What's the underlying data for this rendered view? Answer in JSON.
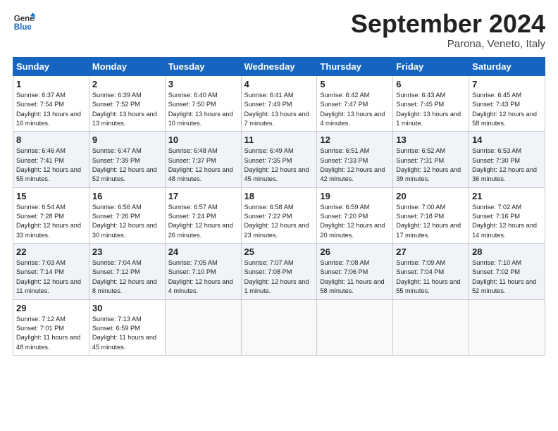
{
  "header": {
    "logo_line1": "General",
    "logo_line2": "Blue",
    "month_title": "September 2024",
    "subtitle": "Parona, Veneto, Italy"
  },
  "weekdays": [
    "Sunday",
    "Monday",
    "Tuesday",
    "Wednesday",
    "Thursday",
    "Friday",
    "Saturday"
  ],
  "weeks": [
    [
      {
        "day": "1",
        "sunrise": "Sunrise: 6:37 AM",
        "sunset": "Sunset: 7:54 PM",
        "daylight": "Daylight: 13 hours and 16 minutes."
      },
      {
        "day": "2",
        "sunrise": "Sunrise: 6:39 AM",
        "sunset": "Sunset: 7:52 PM",
        "daylight": "Daylight: 13 hours and 13 minutes."
      },
      {
        "day": "3",
        "sunrise": "Sunrise: 6:40 AM",
        "sunset": "Sunset: 7:50 PM",
        "daylight": "Daylight: 13 hours and 10 minutes."
      },
      {
        "day": "4",
        "sunrise": "Sunrise: 6:41 AM",
        "sunset": "Sunset: 7:49 PM",
        "daylight": "Daylight: 13 hours and 7 minutes."
      },
      {
        "day": "5",
        "sunrise": "Sunrise: 6:42 AM",
        "sunset": "Sunset: 7:47 PM",
        "daylight": "Daylight: 13 hours and 4 minutes."
      },
      {
        "day": "6",
        "sunrise": "Sunrise: 6:43 AM",
        "sunset": "Sunset: 7:45 PM",
        "daylight": "Daylight: 13 hours and 1 minute."
      },
      {
        "day": "7",
        "sunrise": "Sunrise: 6:45 AM",
        "sunset": "Sunset: 7:43 PM",
        "daylight": "Daylight: 12 hours and 58 minutes."
      }
    ],
    [
      {
        "day": "8",
        "sunrise": "Sunrise: 6:46 AM",
        "sunset": "Sunset: 7:41 PM",
        "daylight": "Daylight: 12 hours and 55 minutes."
      },
      {
        "day": "9",
        "sunrise": "Sunrise: 6:47 AM",
        "sunset": "Sunset: 7:39 PM",
        "daylight": "Daylight: 12 hours and 52 minutes."
      },
      {
        "day": "10",
        "sunrise": "Sunrise: 6:48 AM",
        "sunset": "Sunset: 7:37 PM",
        "daylight": "Daylight: 12 hours and 48 minutes."
      },
      {
        "day": "11",
        "sunrise": "Sunrise: 6:49 AM",
        "sunset": "Sunset: 7:35 PM",
        "daylight": "Daylight: 12 hours and 45 minutes."
      },
      {
        "day": "12",
        "sunrise": "Sunrise: 6:51 AM",
        "sunset": "Sunset: 7:33 PM",
        "daylight": "Daylight: 12 hours and 42 minutes."
      },
      {
        "day": "13",
        "sunrise": "Sunrise: 6:52 AM",
        "sunset": "Sunset: 7:31 PM",
        "daylight": "Daylight: 12 hours and 39 minutes."
      },
      {
        "day": "14",
        "sunrise": "Sunrise: 6:53 AM",
        "sunset": "Sunset: 7:30 PM",
        "daylight": "Daylight: 12 hours and 36 minutes."
      }
    ],
    [
      {
        "day": "15",
        "sunrise": "Sunrise: 6:54 AM",
        "sunset": "Sunset: 7:28 PM",
        "daylight": "Daylight: 12 hours and 33 minutes."
      },
      {
        "day": "16",
        "sunrise": "Sunrise: 6:56 AM",
        "sunset": "Sunset: 7:26 PM",
        "daylight": "Daylight: 12 hours and 30 minutes."
      },
      {
        "day": "17",
        "sunrise": "Sunrise: 6:57 AM",
        "sunset": "Sunset: 7:24 PM",
        "daylight": "Daylight: 12 hours and 26 minutes."
      },
      {
        "day": "18",
        "sunrise": "Sunrise: 6:58 AM",
        "sunset": "Sunset: 7:22 PM",
        "daylight": "Daylight: 12 hours and 23 minutes."
      },
      {
        "day": "19",
        "sunrise": "Sunrise: 6:59 AM",
        "sunset": "Sunset: 7:20 PM",
        "daylight": "Daylight: 12 hours and 20 minutes."
      },
      {
        "day": "20",
        "sunrise": "Sunrise: 7:00 AM",
        "sunset": "Sunset: 7:18 PM",
        "daylight": "Daylight: 12 hours and 17 minutes."
      },
      {
        "day": "21",
        "sunrise": "Sunrise: 7:02 AM",
        "sunset": "Sunset: 7:16 PM",
        "daylight": "Daylight: 12 hours and 14 minutes."
      }
    ],
    [
      {
        "day": "22",
        "sunrise": "Sunrise: 7:03 AM",
        "sunset": "Sunset: 7:14 PM",
        "daylight": "Daylight: 12 hours and 11 minutes."
      },
      {
        "day": "23",
        "sunrise": "Sunrise: 7:04 AM",
        "sunset": "Sunset: 7:12 PM",
        "daylight": "Daylight: 12 hours and 8 minutes."
      },
      {
        "day": "24",
        "sunrise": "Sunrise: 7:05 AM",
        "sunset": "Sunset: 7:10 PM",
        "daylight": "Daylight: 12 hours and 4 minutes."
      },
      {
        "day": "25",
        "sunrise": "Sunrise: 7:07 AM",
        "sunset": "Sunset: 7:08 PM",
        "daylight": "Daylight: 12 hours and 1 minute."
      },
      {
        "day": "26",
        "sunrise": "Sunrise: 7:08 AM",
        "sunset": "Sunset: 7:06 PM",
        "daylight": "Daylight: 11 hours and 58 minutes."
      },
      {
        "day": "27",
        "sunrise": "Sunrise: 7:09 AM",
        "sunset": "Sunset: 7:04 PM",
        "daylight": "Daylight: 11 hours and 55 minutes."
      },
      {
        "day": "28",
        "sunrise": "Sunrise: 7:10 AM",
        "sunset": "Sunset: 7:02 PM",
        "daylight": "Daylight: 11 hours and 52 minutes."
      }
    ],
    [
      {
        "day": "29",
        "sunrise": "Sunrise: 7:12 AM",
        "sunset": "Sunset: 7:01 PM",
        "daylight": "Daylight: 11 hours and 48 minutes."
      },
      {
        "day": "30",
        "sunrise": "Sunrise: 7:13 AM",
        "sunset": "Sunset: 6:59 PM",
        "daylight": "Daylight: 11 hours and 45 minutes."
      },
      null,
      null,
      null,
      null,
      null
    ]
  ]
}
